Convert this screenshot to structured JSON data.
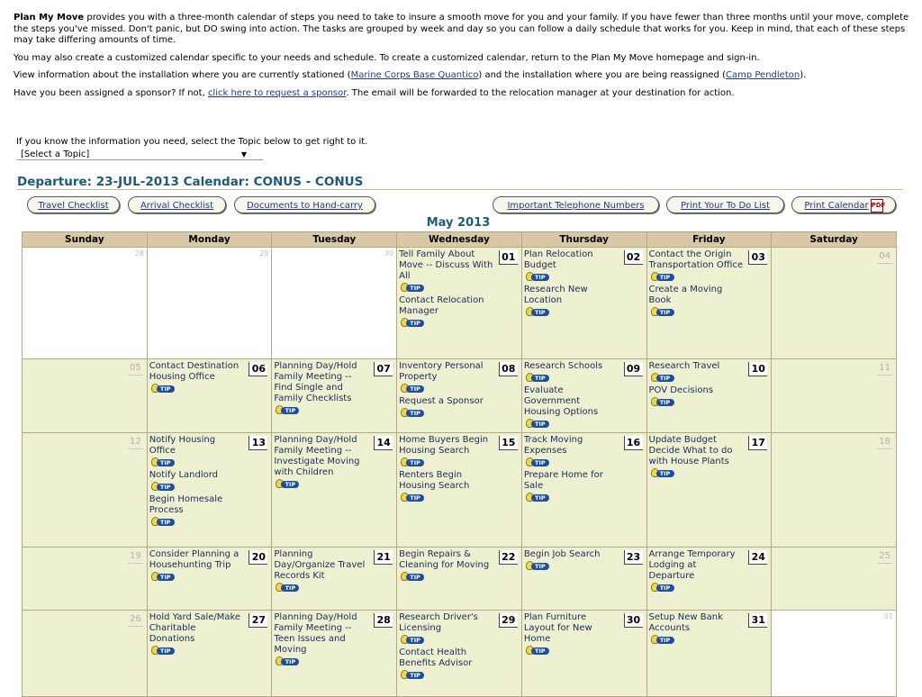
{
  "intro": {
    "p1_bold": "Plan My Move",
    "p1_rest": " provides you with a three-month calendar of steps you need to take to insure a smooth move for you and your family. If you have fewer than three months until your move, complete the steps you've missed. Don't panic, but DO swing into action. The tasks are grouped by week and day so you can follow a daily schedule that works for you. Keep in mind, that each of these steps may take differing amounts of time.",
    "p2": "You may also create a customized calendar specific to your needs and schedule. To create a customized calendar, return to the Plan My Move homepage and sign-in.",
    "p3_a": "View information about the installation where you are currently stationed (",
    "p3_link1": "Marine Corps Base Quantico",
    "p3_b": ") and the installation where you are being reassigned (",
    "p3_link2": "Camp Pendleton",
    "p3_c": ").",
    "p4_a": "Have you been assigned a sponsor? If not, ",
    "p4_link": "click here to request a sponsor",
    "p4_b": ". The email will be forwarded to the relocation manager at your destination for action."
  },
  "topic": {
    "label": "If you know the information you need, select the Topic below to get right to it.",
    "selected": "[Select a Topic]"
  },
  "calendar_title": "Departure: 23-JUL-2013 Calendar: CONUS - CONUS",
  "buttons": {
    "travel": "Travel Checklist",
    "arrival": "Arrival Checklist",
    "documents": "Documents to Hand-carry",
    "phones": "Important Telephone Numbers",
    "todo": "Print Your To Do List",
    "print": "Print Calendar"
  },
  "tip_label": "TIP",
  "pdf_label": "PDF",
  "month": "May 2013",
  "weekdays": [
    "Sunday",
    "Monday",
    "Tuesday",
    "Wednesday",
    "Thursday",
    "Friday",
    "Saturday"
  ],
  "weeks": [
    [
      {
        "day": "28",
        "state": "out",
        "tasks": []
      },
      {
        "day": "29",
        "state": "out",
        "tasks": []
      },
      {
        "day": "30",
        "state": "out",
        "tasks": []
      },
      {
        "day": "01",
        "state": "task",
        "tasks": [
          {
            "t": "Tell Family About Move -- Discuss With All",
            "tip": true
          },
          {
            "t": "Contact Relocation Manager",
            "tip": true
          }
        ]
      },
      {
        "day": "02",
        "state": "task",
        "tasks": [
          {
            "t": "Plan Relocation Budget",
            "tip": true
          },
          {
            "t": "Research New Location",
            "tip": true
          }
        ]
      },
      {
        "day": "03",
        "state": "task",
        "tasks": [
          {
            "t": "Contact the Origin Transportation Office",
            "tip": true
          },
          {
            "t": "Create a Moving Book",
            "tip": true
          }
        ]
      },
      {
        "day": "04",
        "state": "weekend",
        "tasks": []
      }
    ],
    [
      {
        "day": "05",
        "state": "weekend",
        "tasks": []
      },
      {
        "day": "06",
        "state": "task",
        "tasks": [
          {
            "t": "Contact Destination Housing Office",
            "tip": true
          }
        ]
      },
      {
        "day": "07",
        "state": "task",
        "tasks": [
          {
            "t": "Planning Day/Hold Family Meeting -- Find Single and Family Checklists",
            "tip": true
          }
        ]
      },
      {
        "day": "08",
        "state": "task",
        "tasks": [
          {
            "t": "Inventory Personal Property",
            "tip": true
          },
          {
            "t": "Request a Sponsor",
            "tip": true
          }
        ]
      },
      {
        "day": "09",
        "state": "task",
        "tasks": [
          {
            "t": "Research Schools",
            "tip": true
          },
          {
            "t": "Evaluate Government Housing Options",
            "tip": true
          }
        ]
      },
      {
        "day": "10",
        "state": "task",
        "tasks": [
          {
            "t": "Research Travel",
            "tip": true
          },
          {
            "t": "POV Decisions",
            "tip": true
          }
        ]
      },
      {
        "day": "11",
        "state": "weekend",
        "tasks": []
      }
    ],
    [
      {
        "day": "12",
        "state": "weekend",
        "tasks": []
      },
      {
        "day": "13",
        "state": "task",
        "tasks": [
          {
            "t": "Notify Housing Office",
            "tip": true
          },
          {
            "t": "Notify Landlord",
            "tip": true
          },
          {
            "t": "Begin Homesale Process",
            "tip": true
          }
        ]
      },
      {
        "day": "14",
        "state": "task",
        "tasks": [
          {
            "t": "Planning Day/Hold Family Meeting -- Investigate Moving with Children",
            "tip": true
          }
        ]
      },
      {
        "day": "15",
        "state": "task",
        "tasks": [
          {
            "t": "Home Buyers Begin Housing Search",
            "tip": true
          },
          {
            "t": "Renters Begin Housing Search",
            "tip": true
          }
        ]
      },
      {
        "day": "16",
        "state": "task",
        "tasks": [
          {
            "t": "Track Moving Expenses",
            "tip": true
          },
          {
            "t": "Prepare Home for Sale",
            "tip": true
          }
        ]
      },
      {
        "day": "17",
        "state": "task",
        "tasks": [
          {
            "t": "Update Budget",
            "tip": false
          },
          {
            "t": "Decide What to do with House Plants",
            "tip": true
          }
        ]
      },
      {
        "day": "18",
        "state": "weekend",
        "tasks": []
      }
    ],
    [
      {
        "day": "19",
        "state": "weekend",
        "tasks": []
      },
      {
        "day": "20",
        "state": "task",
        "tasks": [
          {
            "t": "Consider Planning a Househunting Trip",
            "tip": true
          }
        ]
      },
      {
        "day": "21",
        "state": "task",
        "tasks": [
          {
            "t": "Planning Day/Organize Travel Records Kit",
            "tip": true
          }
        ]
      },
      {
        "day": "22",
        "state": "task",
        "tasks": [
          {
            "t": "Begin Repairs & Cleaning for Moving",
            "tip": true
          }
        ]
      },
      {
        "day": "23",
        "state": "task",
        "tasks": [
          {
            "t": "Begin Job Search",
            "tip": true
          }
        ]
      },
      {
        "day": "24",
        "state": "task",
        "tasks": [
          {
            "t": "Arrange Temporary Lodging at Departure",
            "tip": true
          }
        ]
      },
      {
        "day": "25",
        "state": "weekend",
        "tasks": []
      }
    ],
    [
      {
        "day": "26",
        "state": "weekend",
        "tasks": []
      },
      {
        "day": "27",
        "state": "task",
        "tasks": [
          {
            "t": "Hold Yard Sale/Make Charitable Donations",
            "tip": true
          }
        ]
      },
      {
        "day": "28",
        "state": "task",
        "tasks": [
          {
            "t": "Planning Day/Hold Family Meeting -- Teen Issues and Moving",
            "tip": true
          }
        ]
      },
      {
        "day": "29",
        "state": "task",
        "tasks": [
          {
            "t": "Research Driver's Licensing",
            "tip": true
          },
          {
            "t": "Contact Health Benefits Advisor",
            "tip": true
          }
        ]
      },
      {
        "day": "30",
        "state": "task",
        "tasks": [
          {
            "t": "Plan Furniture Layout for New Home",
            "tip": true
          }
        ]
      },
      {
        "day": "31",
        "state": "task",
        "tasks": [
          {
            "t": "Setup New Bank Accounts",
            "tip": true
          }
        ]
      },
      {
        "day": "01",
        "state": "out",
        "tasks": []
      }
    ]
  ]
}
